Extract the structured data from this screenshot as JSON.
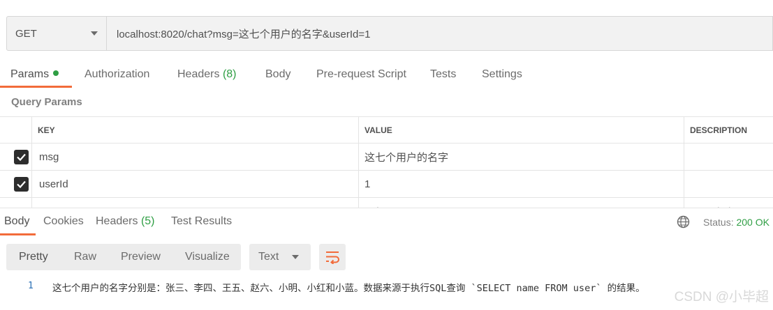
{
  "request": {
    "method": "GET",
    "url": "localhost:8020/chat?msg=这七个用户的名字&userId=1"
  },
  "request_tabs": {
    "params": "Params",
    "authorization": "Authorization",
    "headers": "Headers",
    "headers_count": "(8)",
    "body": "Body",
    "prerequest": "Pre-request Script",
    "tests": "Tests",
    "settings": "Settings"
  },
  "query_params": {
    "title": "Query Params",
    "columns": {
      "key": "KEY",
      "value": "VALUE",
      "description": "DESCRIPTION"
    },
    "rows": [
      {
        "checked": true,
        "key": "msg",
        "value": "这七个用户的名字",
        "description": ""
      },
      {
        "checked": true,
        "key": "userId",
        "value": "1",
        "description": ""
      }
    ],
    "placeholder": {
      "key": "Key",
      "value": "Value",
      "description": "Description"
    }
  },
  "response_tabs": {
    "body": "Body",
    "cookies": "Cookies",
    "headers": "Headers",
    "headers_count": "(5)",
    "test_results": "Test Results"
  },
  "status": {
    "label": "Status:",
    "value": "200 OK"
  },
  "view_modes": {
    "pretty": "Pretty",
    "raw": "Raw",
    "preview": "Preview",
    "visualize": "Visualize"
  },
  "format": {
    "selected": "Text"
  },
  "response_body": {
    "line_number": "1",
    "text": "这七个用户的名字分别是：张三、李四、王五、赵六、小明、小红和小蓝。数据来源于执行SQL查询 `SELECT name FROM user` 的结果。"
  },
  "watermark": "CSDN @小毕超",
  "colors": {
    "accent": "#f26b3a",
    "success": "#2f9e44",
    "checkbox": "#2d2d2d"
  }
}
